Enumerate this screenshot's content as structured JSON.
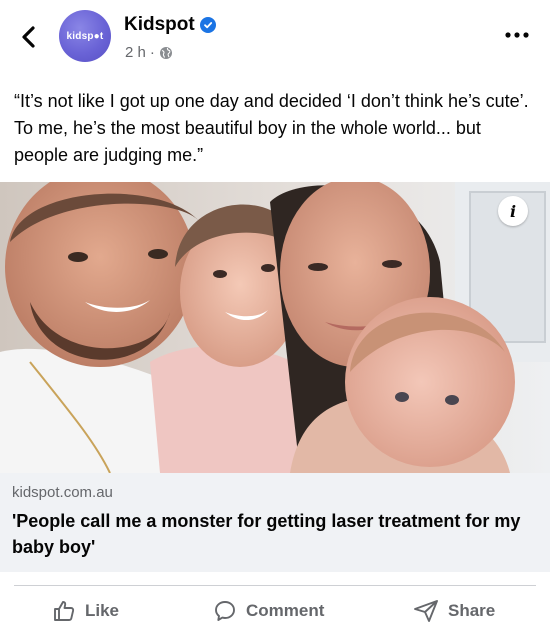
{
  "header": {
    "back_icon": "chevron-left-icon",
    "avatar_text": "kidsp●t",
    "page_name": "Kidspot",
    "verified_icon": "verified-badge-icon",
    "time": "2 h",
    "separator": "·",
    "audience_icon": "globe-icon",
    "more_icon": "more-dots-icon"
  },
  "post": {
    "text": "“It’s not like I got up one day and decided ‘I don’t think he’s cute’. To me, he’s the most beautiful boy in the whole world... but people are judging me.”"
  },
  "photo": {
    "info_label": "i"
  },
  "link_preview": {
    "domain": "kidspot.com.au",
    "title": "'People call me a monster for getting laser treatment for my baby boy'"
  },
  "actions": {
    "like": "Like",
    "comment": "Comment",
    "share": "Share"
  },
  "colors": {
    "accent": "#1b74e4",
    "secondary_text": "#65676b",
    "link_preview_bg": "#f0f2f5",
    "avatar_purple": "#6a63d6"
  }
}
